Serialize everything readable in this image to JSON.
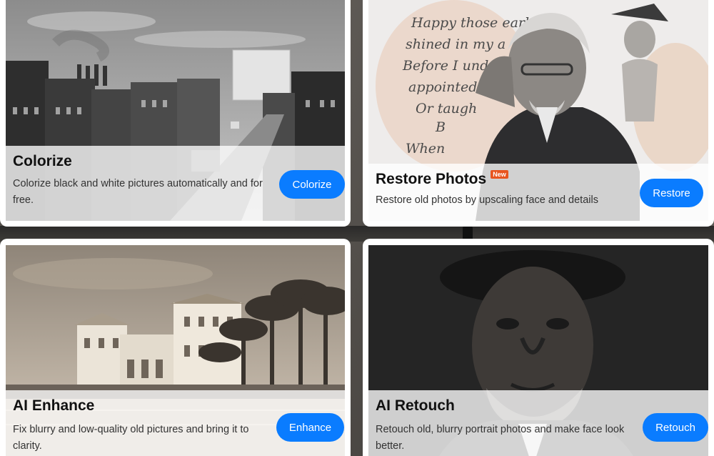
{
  "cards": [
    {
      "title": "Colorize",
      "description": "Colorize black and white pictures automatically and for free.",
      "button": "Colorize",
      "badge": ""
    },
    {
      "title": "Restore Photos",
      "description": "Restore old photos by upscaling face and details",
      "button": "Restore",
      "badge": "New"
    },
    {
      "title": "AI Enhance",
      "description": "Fix blurry and low-quality old pictures and bring it to clarity.",
      "button": "Enhance",
      "badge": ""
    },
    {
      "title": "AI Retouch",
      "description": "Retouch old, blurry portrait photos and make face look better.",
      "button": "Retouch",
      "badge": ""
    }
  ],
  "poem_lines": [
    "Happy those early",
    "shined in my a",
    "Before I unde",
    "appointed fo",
    "Or taugh",
    "B",
    "When"
  ],
  "colors": {
    "button": "#0a7cff",
    "badge": "#e8551f"
  }
}
